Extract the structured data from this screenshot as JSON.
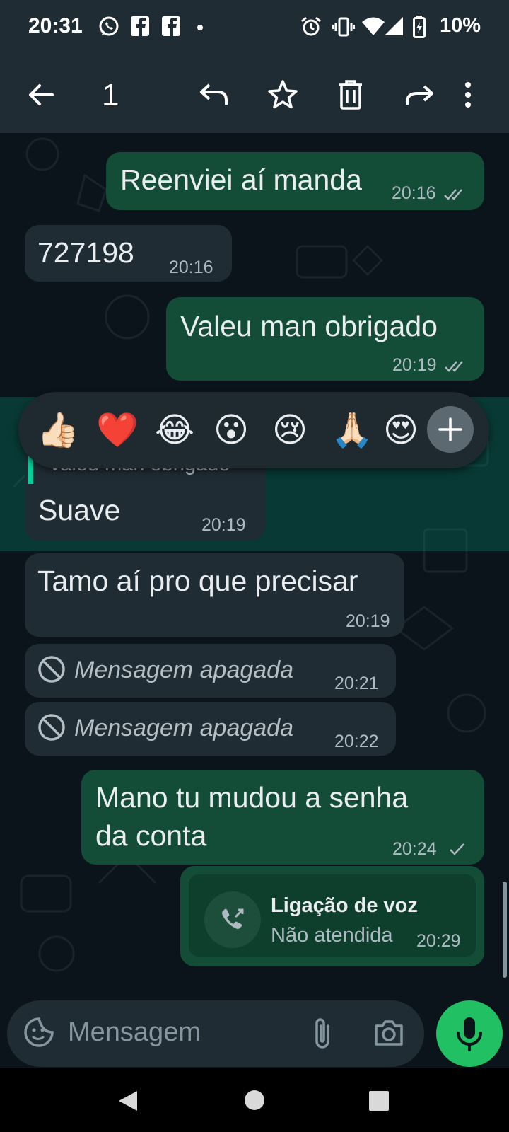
{
  "status_bar": {
    "time": "20:31",
    "battery": "10%",
    "icons": [
      "whatsapp-icon",
      "facebook-icon",
      "facebook-icon",
      "dot-icon",
      "alarm-icon",
      "vibrate-icon",
      "wifi-icon",
      "signal-icon",
      "battery-icon"
    ]
  },
  "action_bar": {
    "selected_count": "1",
    "icons": [
      "back-arrow-icon",
      "reply-icon",
      "star-icon",
      "delete-icon",
      "forward-icon",
      "more-icon"
    ]
  },
  "messages": [
    {
      "direction": "out",
      "text": "Reenviei aí manda",
      "time": "20:16",
      "status": "read"
    },
    {
      "direction": "in",
      "text": "727198",
      "time": "20:16"
    },
    {
      "direction": "out",
      "text": "Valeu man obrigado",
      "time": "20:19",
      "status": "read"
    },
    {
      "direction": "in",
      "quoted": "Valeu man obrigado",
      "text": "Suave",
      "time": "20:19",
      "selected": true
    },
    {
      "direction": "in",
      "text": "Tamo aí pro que precisar",
      "time": "20:19"
    },
    {
      "direction": "in",
      "text": "Mensagem apagada",
      "time": "20:21",
      "deleted": true
    },
    {
      "direction": "in",
      "text": "Mensagem apagada",
      "time": "20:22",
      "deleted": true
    },
    {
      "direction": "out",
      "text_lines": [
        "Mano tu mudou a senha",
        "da conta"
      ],
      "time": "20:24",
      "status": "sent"
    },
    {
      "direction": "out",
      "call": true,
      "title": "Ligação de voz",
      "subtitle": "Não atendida",
      "time": "20:29"
    }
  ],
  "reactions": [
    "👍🏻",
    "❤️",
    "😂",
    "😮",
    "😢",
    "🙏🏻",
    "😍"
  ],
  "composer": {
    "placeholder": "Mensagem",
    "icons": [
      "sticker-icon",
      "attach-icon",
      "camera-icon",
      "mic-icon"
    ]
  },
  "colors": {
    "background": "#0b141a",
    "bar": "#1f2c34",
    "outgoing_bubble": "#144d37",
    "incoming_bubble": "#202c33",
    "mic_button": "#21c063",
    "read_tick": "#aebac1"
  }
}
